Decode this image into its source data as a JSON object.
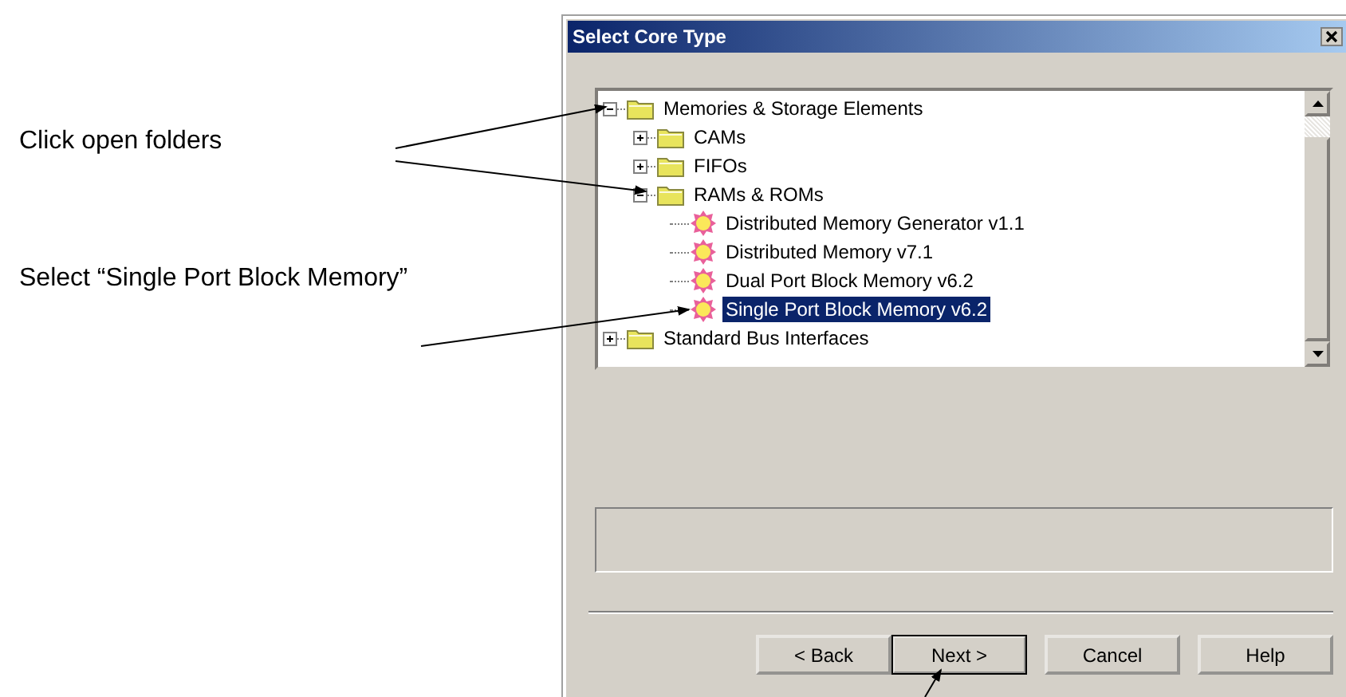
{
  "annotations": [
    {
      "text": "Click open folders"
    },
    {
      "text": "Select “Single Port Block Memory”"
    }
  ],
  "window": {
    "title": "Select Core Type"
  },
  "tree": {
    "items": [
      {
        "label": "Memories & Storage Elements",
        "kind": "folder",
        "expanded": true,
        "selected": false,
        "children": [
          {
            "label": "CAMs",
            "kind": "folder",
            "expanded": false,
            "selected": false
          },
          {
            "label": "FIFOs",
            "kind": "folder",
            "expanded": false,
            "selected": false
          },
          {
            "label": "RAMs & ROMs",
            "kind": "folder",
            "expanded": true,
            "selected": false,
            "children": [
              {
                "label": "Distributed Memory Generator v1.1",
                "kind": "core",
                "selected": false
              },
              {
                "label": "Distributed Memory v7.1",
                "kind": "core",
                "selected": false
              },
              {
                "label": "Dual Port Block Memory v6.2",
                "kind": "core",
                "selected": false
              },
              {
                "label": "Single Port Block Memory v6.2",
                "kind": "core",
                "selected": true
              }
            ]
          }
        ]
      },
      {
        "label": "Standard Bus Interfaces",
        "kind": "folder",
        "expanded": false,
        "selected": false
      }
    ]
  },
  "buttons": [
    {
      "label": "< Back",
      "default": false
    },
    {
      "label": "Next >",
      "default": true
    },
    {
      "label": "Cancel",
      "default": false
    },
    {
      "label": "Help",
      "default": false
    }
  ]
}
